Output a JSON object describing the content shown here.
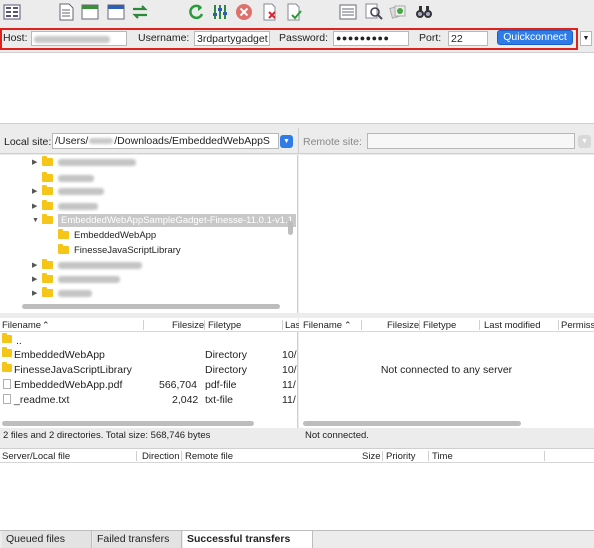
{
  "toolbar": {
    "icons": [
      "site-manager-icon",
      "message-log-icon",
      "local-tree-icon",
      "remote-tree-icon",
      "transfer-queue-icon",
      "refresh-icon",
      "filter-icon",
      "cancel-icon",
      "disconnect-icon",
      "reconnect-icon",
      "directory-comparison-icon",
      "search-icon",
      "sync-browsing-icon",
      "find-files-icon"
    ]
  },
  "quickconnect": {
    "host_label": "Host:",
    "username_label": "Username:",
    "username_value": "3rdpartygadget",
    "password_label": "Password:",
    "password_value": "●●●●●●●●●",
    "port_label": "Port:",
    "port_value": "22",
    "button_label": "Quickconnect",
    "dropdown_arrow": "▼"
  },
  "local_site": {
    "label": "Local site:",
    "path_prefix": "/Users/",
    "path_suffix": "/Downloads/EmbeddedWebAppS",
    "tree": {
      "selected": "EmbeddedWebAppSampleGadget-Finesse-11.0.1-v1.1",
      "children": [
        "EmbeddedWebApp",
        "FinesseJavaScriptLibrary"
      ]
    },
    "columns": [
      "Filename",
      "Filesize",
      "Filetype",
      "Las"
    ],
    "files": [
      {
        "name": "..",
        "size": "",
        "type": "",
        "date": ""
      },
      {
        "name": "EmbeddedWebApp",
        "size": "",
        "type": "Directory",
        "date": "10/"
      },
      {
        "name": "FinesseJavaScriptLibrary",
        "size": "",
        "type": "Directory",
        "date": "10/"
      },
      {
        "name": "EmbeddedWebApp.pdf",
        "size": "566,704",
        "type": "pdf-file",
        "date": "11/"
      },
      {
        "name": "_readme.txt",
        "size": "2,042",
        "type": "txt-file",
        "date": "11/"
      }
    ],
    "status": "2 files and 2 directories. Total size: 568,746 bytes"
  },
  "remote_site": {
    "label": "Remote site:",
    "path": "",
    "columns": [
      "Filename",
      "Filesize",
      "Filetype",
      "Last modified",
      "Permiss"
    ],
    "empty_message": "Not connected to any server",
    "status": "Not connected."
  },
  "queue": {
    "columns": [
      "Server/Local file",
      "Direction",
      "Remote file",
      "Size",
      "Priority",
      "Time"
    ],
    "tabs": [
      "Queued files",
      "Failed transfers",
      "Successful transfers"
    ]
  },
  "colors": {
    "accent": "#2f7ce8",
    "highlight_border": "#e0201b",
    "folder": "#f5c518"
  }
}
